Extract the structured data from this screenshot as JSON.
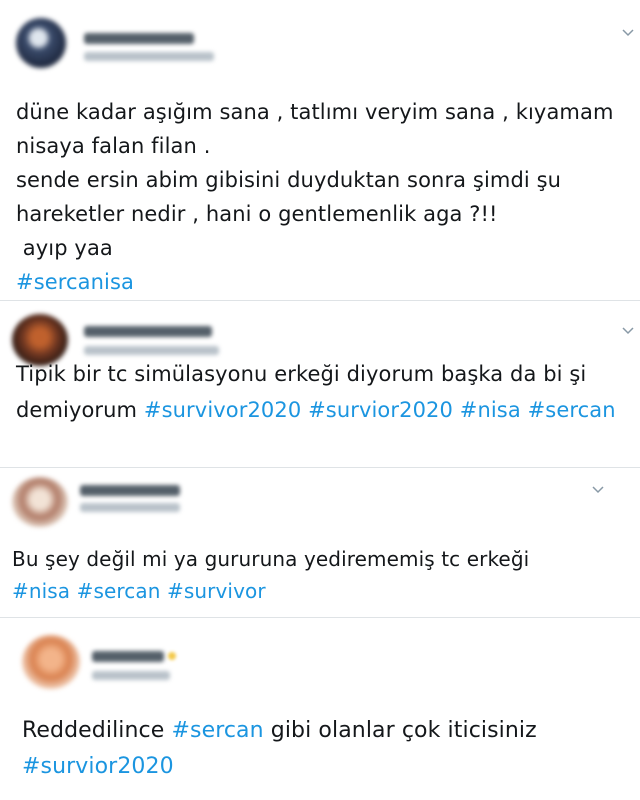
{
  "tweets": [
    {
      "author_name": "",
      "author_handle": "",
      "avatar_color": "#2b3a55",
      "lines": [
        {
          "text": "düne kadar aşığım sana , tatlımı veryim sana , kıyamam",
          "hashtags": []
        },
        {
          "text": "nisaya falan filan .",
          "hashtags": []
        },
        {
          "text": "sende ersin abim gibisini duyduktan sonra şimdi şu",
          "hashtags": []
        },
        {
          "text": "hareketler nedir , hani o gentlemenlik aga ?!!",
          "hashtags": []
        },
        {
          "text": " ayıp yaa",
          "hashtags": []
        },
        {
          "text": "",
          "hashtags": [
            "#sercanisa"
          ]
        }
      ]
    },
    {
      "author_name": "",
      "author_handle": "",
      "avatar_color": "#6b3420",
      "lines": [
        {
          "text": "Tipik bir tc simülasyonu erkeği diyorum başka da bi şi",
          "hashtags": []
        },
        {
          "text": "demiyorum ",
          "hashtags": [
            "#survivor2020",
            "#survior2020",
            "#nisa",
            "#sercan"
          ]
        }
      ]
    },
    {
      "author_name": "",
      "author_handle": "",
      "avatar_color": "#b07a66",
      "lines": [
        {
          "text": "Bu şey değil mi ya gururuna yedirememiş tc erkeği",
          "hashtags": []
        },
        {
          "text": "",
          "hashtags": [
            "#nisa",
            "#sercan",
            "#survivor"
          ]
        }
      ]
    },
    {
      "author_name": "",
      "author_handle": "",
      "avatar_color": "#d9814f",
      "lines": [
        {
          "text": "Reddedilince ",
          "hashtags": [
            "#sercan"
          ],
          "suffix": " gibi olanlar çok iticisiniz"
        },
        {
          "text": "",
          "hashtags": [
            "#survior2020"
          ]
        }
      ]
    }
  ],
  "colors": {
    "hashtag": "#1b95e0",
    "divider": "#dfe3e6",
    "text": "#14171a"
  },
  "icons": {
    "more": "chevron-down-icon"
  }
}
